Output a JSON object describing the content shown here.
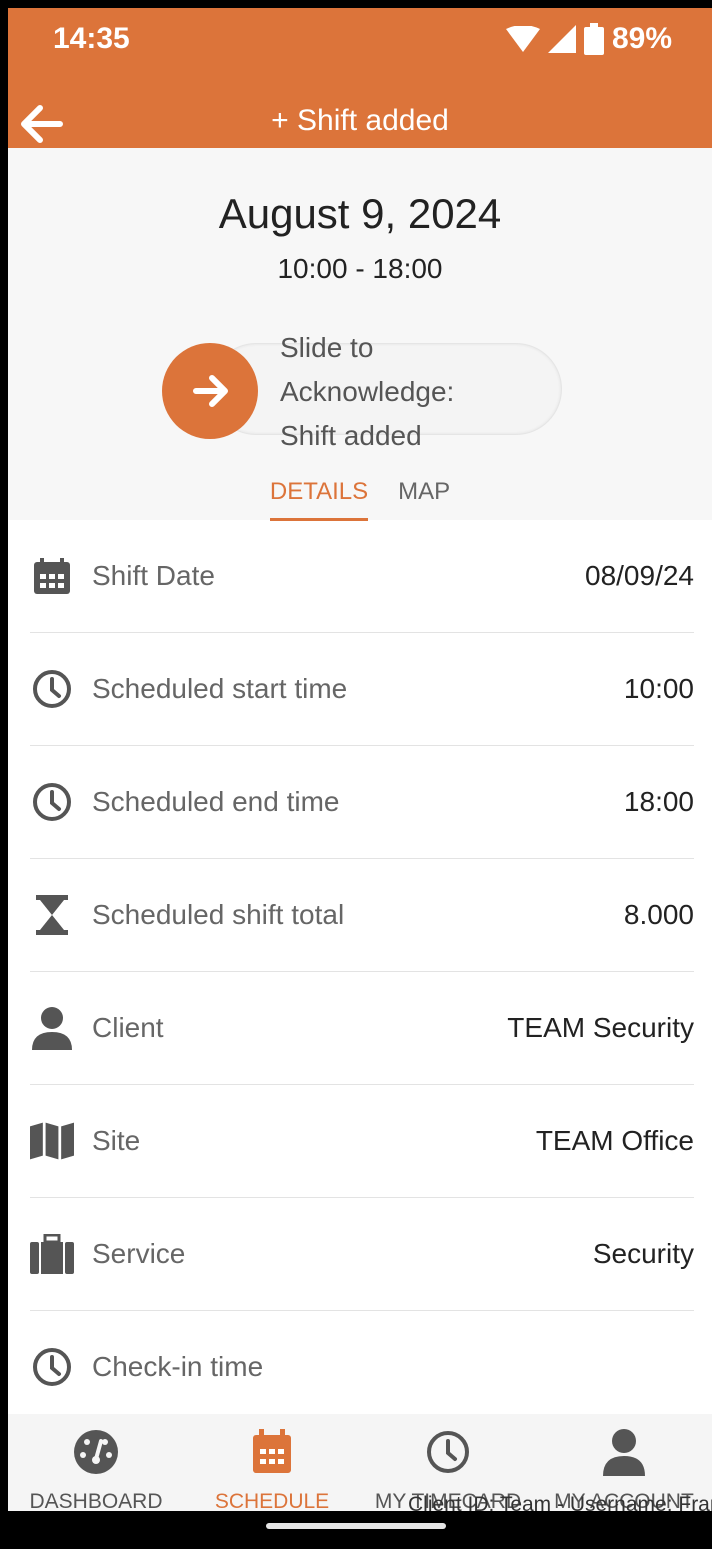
{
  "status": {
    "time": "14:35",
    "battery": "89%"
  },
  "header": {
    "title": "Shift added",
    "plus": "+"
  },
  "shift": {
    "date": "August 9, 2024",
    "time_range": "10:00 - 18:00"
  },
  "slider": {
    "text": "Slide to Acknowledge: Shift added"
  },
  "tabs": [
    {
      "label": "DETAILS",
      "active": true
    },
    {
      "label": "MAP",
      "active": false
    }
  ],
  "rows": [
    {
      "icon": "calendar-icon",
      "label": "Shift Date",
      "value": "08/09/24"
    },
    {
      "icon": "clock-icon",
      "label": "Scheduled start time",
      "value": "10:00"
    },
    {
      "icon": "clock-icon",
      "label": "Scheduled end time",
      "value": "18:00"
    },
    {
      "icon": "hourglass-icon",
      "label": "Scheduled shift total",
      "value": "8.000"
    },
    {
      "icon": "person-icon",
      "label": "Client",
      "value": "TEAM Security"
    },
    {
      "icon": "map-icon",
      "label": "Site",
      "value": "TEAM Office"
    },
    {
      "icon": "briefcase-icon",
      "label": "Service",
      "value": "Security"
    },
    {
      "icon": "clock-icon",
      "label": "Check-in time",
      "value": ""
    }
  ],
  "nav": [
    {
      "icon": "dashboard-icon",
      "label": "DASHBOARD",
      "active": false
    },
    {
      "icon": "calendar-icon",
      "label": "SCHEDULE",
      "active": true
    },
    {
      "icon": "clock-icon",
      "label": "MY TIMECARD",
      "active": false
    },
    {
      "icon": "person-icon",
      "label": "MY ACCOUNT",
      "active": false
    }
  ],
  "footer_overlay": "Client ID: Team - Username: Frankh",
  "colors": {
    "accent": "#dc743a",
    "icon_gray": "#555555"
  }
}
